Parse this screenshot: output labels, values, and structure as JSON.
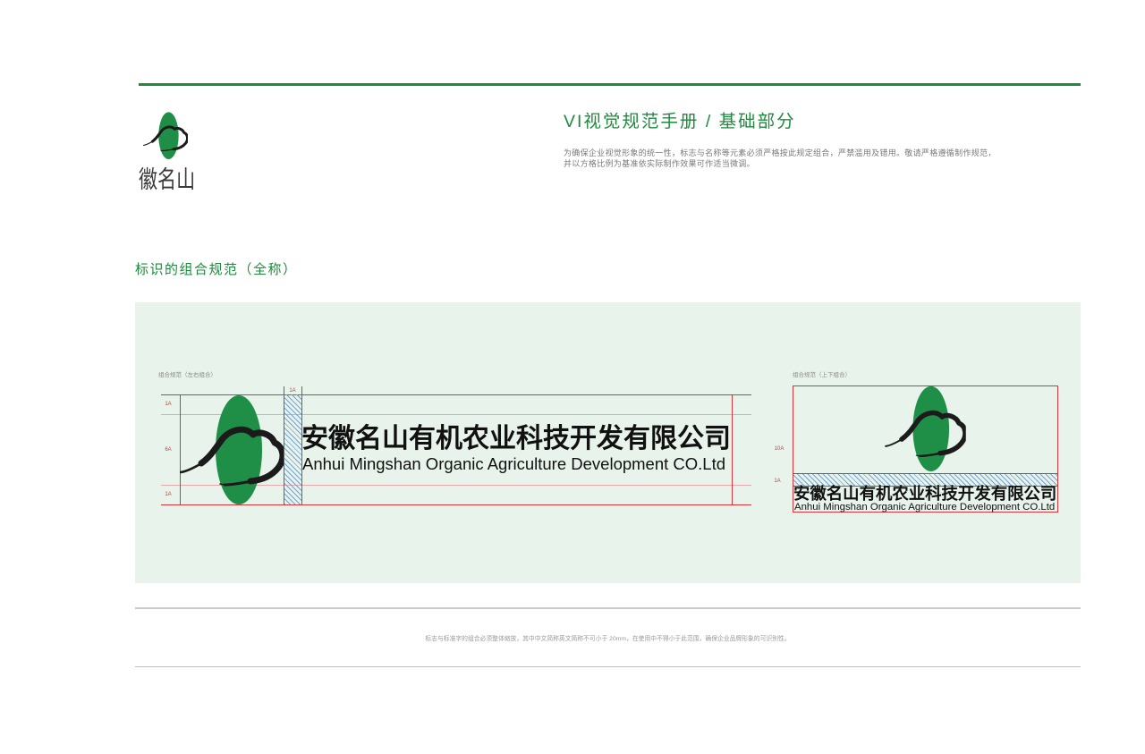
{
  "header": {
    "brand_name": "徽名山",
    "title": "VI视觉规范手册 / 基础部分",
    "description_lines": [
      "为确保企业视觉形象的统一性，标志与名称等元素必须严格按此规定组合，严禁滥用及错用。敬请严格遵循制作规范，",
      "并以方格比例为基准依实际制作效果可作适当微调。"
    ]
  },
  "section": {
    "title": "标识的组合规范（全称）"
  },
  "company": {
    "name_cn": "安徽名山有机农业科技开发有限公司",
    "name_en": "Anhui Mingshan Organic Agriculture Development CO.Ltd"
  },
  "horizontal_combo": {
    "label": "组合规范（左右组合）",
    "units": {
      "top": "1A",
      "middle": "6A",
      "bottom": "1A",
      "gap": "1A"
    }
  },
  "vertical_combo": {
    "label": "组合规范（上下组合）",
    "units": {
      "logo": "10A",
      "gap": "1A"
    }
  },
  "footer": {
    "note": "标志与标准字的组合必须整体缩放，其中中文简称英文简称不可小于 20mm，在使用中不得小于此范围，确保企业品牌形象的可识别性。"
  },
  "icons": {
    "logo": "mingshan-logo-icon"
  },
  "colors": {
    "brand_green": "#1e8a3e",
    "logo_green": "#1f8f47",
    "panel_background": "#e8f3ec",
    "guide_red": "#d8353b",
    "hatch_blue": "#6ea0d4"
  }
}
